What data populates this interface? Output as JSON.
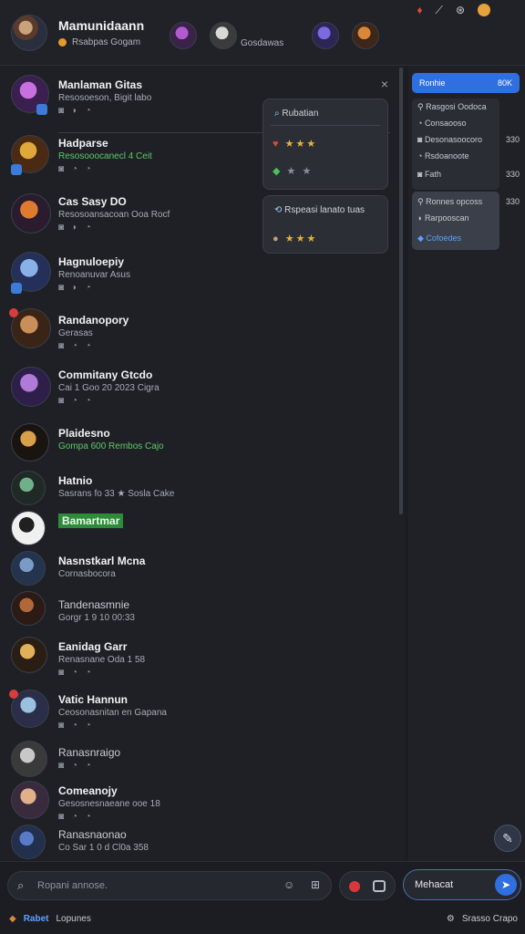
{
  "header": {
    "user_name": "Mamunidaann",
    "user_status": "Rsabpas Gogam",
    "status_extra": "Gosdawas",
    "top_icons": [
      "♦",
      "⟋",
      "⊛",
      "●"
    ]
  },
  "list": {
    "close": "×",
    "rows": [
      {
        "name": "Manlaman Gitas",
        "sub": "Resosoeson, Bigit labo",
        "icons": "◙ ◗ ◔",
        "sub_green": false
      },
      {
        "name": "Hadparse",
        "sub": "Resosooocanecl 4 Ceit",
        "icons": "◙ ◔ ◔",
        "sub_green": true
      },
      {
        "name": "Cas Sasy DO",
        "sub": "Resosoansacoan Ooa Rocf",
        "icons": "◙ ◗ ◔",
        "sub_green": false
      },
      {
        "name": "Hagnuloepiy",
        "sub": "Renoanuvar Asus",
        "icons": "◙ ◗ ◔",
        "sub_green": false
      },
      {
        "name": "Randanopory",
        "sub": "Gerasas",
        "icons": "◙ ◔ ◔",
        "sub_green": false
      },
      {
        "name": "Commitany Gtcdo",
        "sub": "Cai 1 Goo 20 2023 Cigra",
        "icons": "◙ ◔ ◔",
        "sub_green": false
      },
      {
        "name": "Plaidesno",
        "sub": "Gompa 600 Rembos Cajo",
        "icons": "",
        "sub_green": false
      },
      {
        "name": "Hatnio",
        "sub": "Sasrans fo 33 ★ Sosla Cake",
        "icons": "",
        "sub_green": false
      },
      {
        "name": "Bamartmar",
        "sub": "",
        "icons": "◙ ◔ ◔",
        "sub_green": false
      },
      {
        "name": "Nasnstkarl Mcna",
        "sub": "Cornasbocora",
        "icons": "",
        "sub_green": false
      },
      {
        "name": "Tandenasmnie",
        "sub": "Gorgr 1 9 10 00:33",
        "icons": "",
        "sub_green": false
      },
      {
        "name": "Eanidag Garr",
        "sub": "Renasnane Oda 1 58",
        "icons": "◙ ◔ ◔",
        "sub_green": false
      },
      {
        "name": "Vatic Hannun",
        "sub": "Ceosonasnitan en Gapana",
        "icons": "◙ ◔ ◔",
        "sub_green": false
      },
      {
        "name": "Ranasnraigo",
        "sub": "",
        "icons": "◙ ◔ ◔",
        "sub_green": false
      },
      {
        "name": "Comeanojy",
        "sub": "Gesosnesnaeane ooe 18",
        "icons": "◙ ◔ ◔",
        "sub_green": false
      },
      {
        "name": "Ranasnaonao",
        "sub": "Co Sar 1 0 d Cl0a 358",
        "icons": "",
        "sub_green": false
      }
    ]
  },
  "popup_top": {
    "title": "Rubatian",
    "rows": [
      "★★★",
      "★ ★"
    ]
  },
  "popup_bottom": {
    "title": "Rspeasi lanato tuas",
    "rows": [
      "★★★"
    ]
  },
  "right_panel": {
    "top_label": "Ronhie",
    "top_num": "80K",
    "items": [
      {
        "label": "Rasgosi Oodoca",
        "num": ""
      },
      {
        "label": "Consaooso",
        "num": ""
      },
      {
        "label": "Desonasoocoro",
        "num": "330"
      },
      {
        "label": "Rsdoanoote",
        "num": ""
      },
      {
        "label": "Fath",
        "num": "330"
      }
    ],
    "box_items": [
      "Ronnes opcoss",
      "Rarpooscan"
    ],
    "box_num": "330",
    "link": "Cofoedes"
  },
  "composer": {
    "search_placeholder": "Ropani annose.",
    "message_placeholder": "Mehacat"
  },
  "footer": {
    "left_label": "Rabet",
    "left_extra": "Lopunes",
    "right_label": "Srasso Crapo"
  }
}
